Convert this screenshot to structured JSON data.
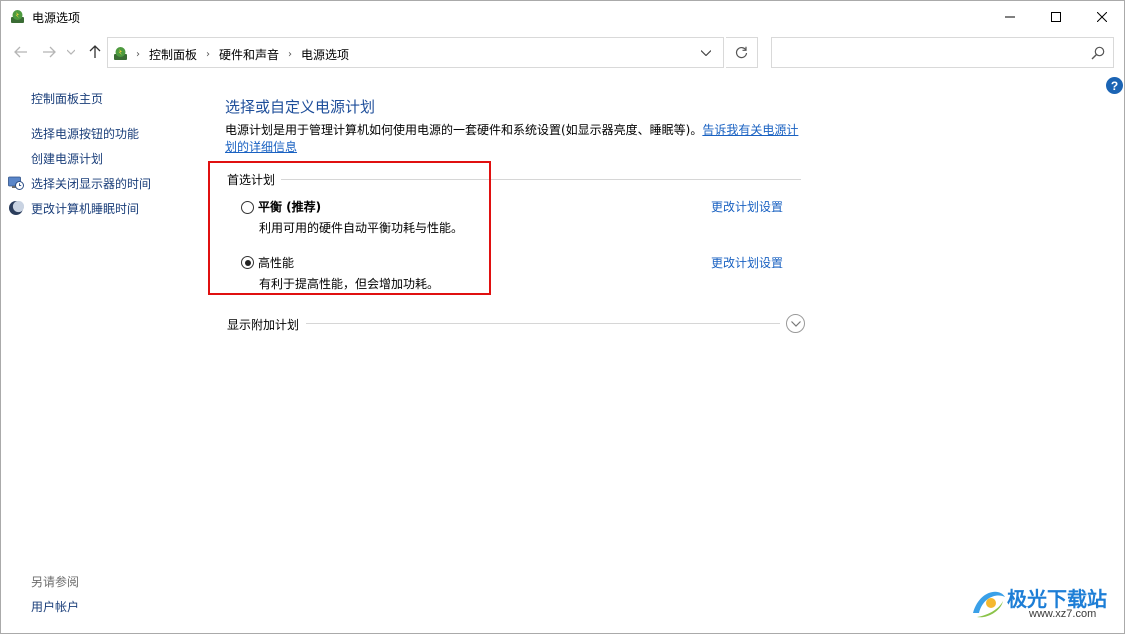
{
  "window": {
    "title": "电源选项",
    "controls": {
      "minimize": "minimize",
      "maximize": "maximize",
      "close": "close"
    }
  },
  "nav": {
    "back_icon": "arrow-left-icon",
    "forward_icon": "arrow-right-icon",
    "up_icon": "arrow-up-icon",
    "breadcrumbs": [
      "控制面板",
      "硬件和声音",
      "电源选项"
    ],
    "search_placeholder": ""
  },
  "help": {
    "label": "?"
  },
  "sidebar": {
    "home": "控制面板主页",
    "items": [
      {
        "label": "选择电源按钮的功能",
        "icon": ""
      },
      {
        "label": "创建电源计划",
        "icon": ""
      },
      {
        "label": "选择关闭显示器的时间",
        "icon": "monitor-clock-icon"
      },
      {
        "label": "更改计算机睡眠时间",
        "icon": "moon-icon"
      }
    ],
    "see_also": "另请参阅",
    "user_accounts": "用户帐户"
  },
  "main": {
    "heading": "选择或自定义电源计划",
    "description": "电源计划是用于管理计算机如何使用电源的一套硬件和系统设置(如显示器亮度、睡眠等)。",
    "description_link": "告诉我有关电源计划的详细信息",
    "preferred_label": "首选计划",
    "plans": [
      {
        "name": "平衡 (推荐)",
        "description": "利用可用的硬件自动平衡功耗与性能。",
        "selected": false,
        "change_link": "更改计划设置"
      },
      {
        "name": "高性能",
        "description": "有利于提高性能，但会增加功耗。",
        "selected": true,
        "change_link": "更改计划设置"
      }
    ],
    "show_additional": "显示附加计划"
  },
  "watermark": {
    "text": "极光下载站",
    "url": "www.xz7.com"
  },
  "colors": {
    "link": "#1a62c2",
    "heading": "#1e4e9a",
    "highlight": "#e01010",
    "help": "#1b64b4"
  }
}
